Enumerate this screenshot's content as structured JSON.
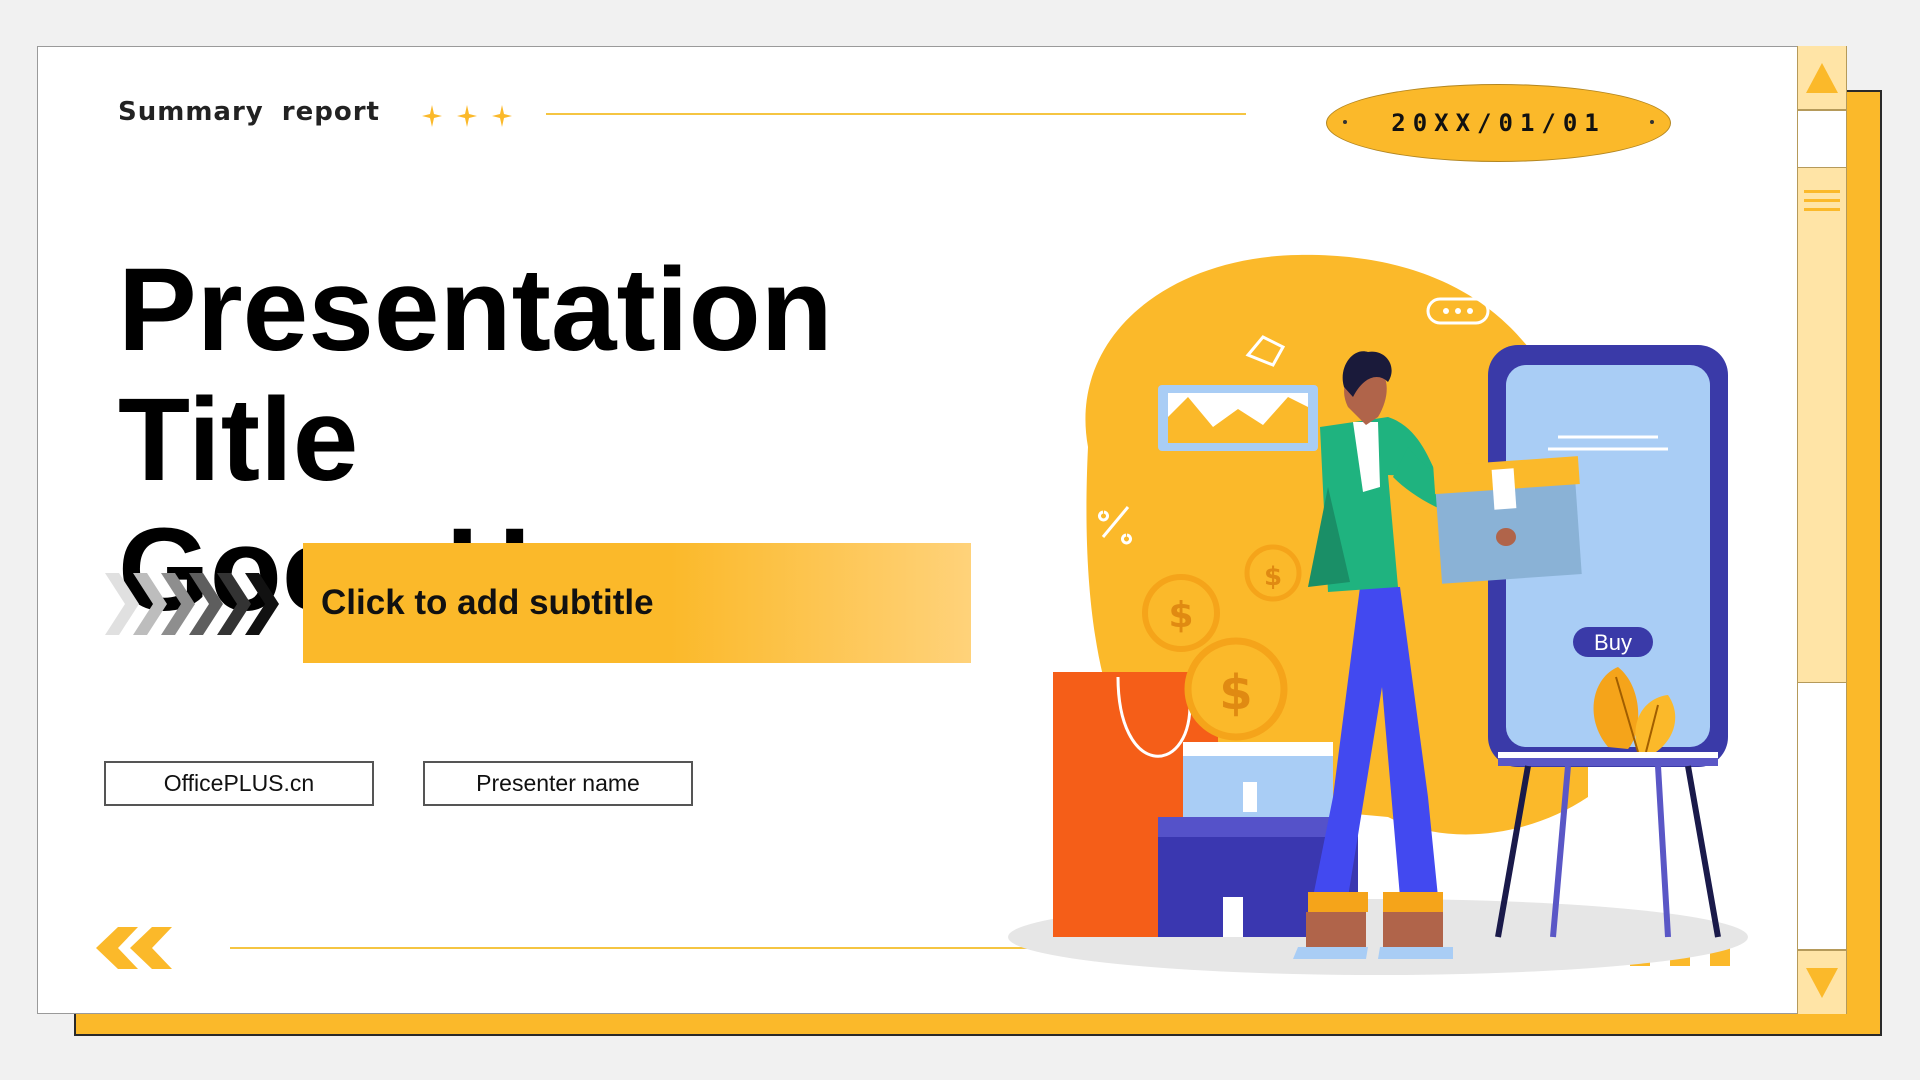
{
  "slide": {
    "header_label": "Summary  report",
    "date": "20XX/01/01",
    "title_line1": "Presentation Title",
    "title_line2": "Goes Here",
    "subtitle": "Click to add subtitle",
    "website": "OfficePLUS.cn",
    "presenter": "Presenter name",
    "buy_label": "Buy"
  },
  "icons": {
    "sparkles": "sparkle-icon",
    "chevrons": "chevron-right-icon",
    "left_arrows": "double-chevron-left-icon",
    "scroll_up": "triangle-up-icon",
    "scroll_down": "triangle-down-icon",
    "scroll_grip": "grip-lines-icon"
  },
  "colors": {
    "accent": "#fbb92a",
    "accent_light": "#ffe4a6",
    "text": "#000000",
    "phone_frame": "#3a3aa8",
    "phone_screen": "#a9cdf5",
    "jacket": "#1fb37f",
    "pants": "#4249f0",
    "bag": "#f55e18"
  }
}
